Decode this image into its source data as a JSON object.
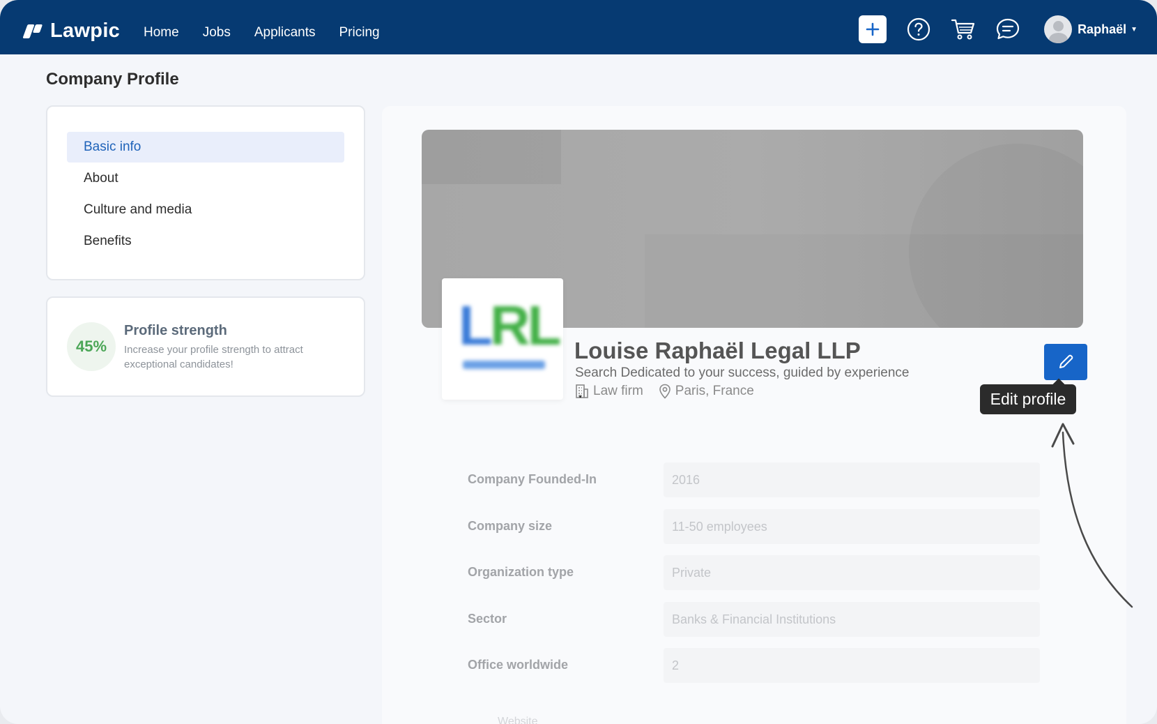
{
  "app": {
    "logo_text": "Lawpic"
  },
  "nav": {
    "links": [
      "Home",
      "Jobs",
      "Applicants",
      "Pricing"
    ],
    "user_name": "Raphaël",
    "icons": [
      "plus-icon",
      "help-icon",
      "cart-icon",
      "chat-icon",
      "avatar"
    ]
  },
  "page": {
    "title": "Company Profile"
  },
  "sidebar": {
    "items": [
      {
        "label": "Basic info",
        "active": true
      },
      {
        "label": "About",
        "active": false
      },
      {
        "label": "Culture and media",
        "active": false
      },
      {
        "label": "Benefits",
        "active": false
      }
    ]
  },
  "strength": {
    "percent_label": "45%",
    "percent": 45,
    "title": "Profile strength",
    "description": "Increase your profile strength to attract exceptional candidates!"
  },
  "company": {
    "logo_text": "LRL",
    "name": "Louise Raphaël Legal LLP",
    "tagline": "Search Dedicated to your success, guided by experience",
    "type": "Law firm",
    "location": "Paris, France"
  },
  "edit": {
    "tooltip": "Edit profile"
  },
  "fields": [
    {
      "label": "Company Founded-In",
      "value": "2016"
    },
    {
      "label": "Company size",
      "value": "11-50 employees"
    },
    {
      "label": "Organization type",
      "value": "Private"
    },
    {
      "label": "Sector",
      "value": "Banks & Financial Institutions"
    },
    {
      "label": "Office worldwide",
      "value": "2"
    }
  ],
  "faded_next_label": "Website",
  "colors": {
    "navbar": "#063a72",
    "accent": "#1765c8",
    "strength_green": "#4ba657"
  }
}
